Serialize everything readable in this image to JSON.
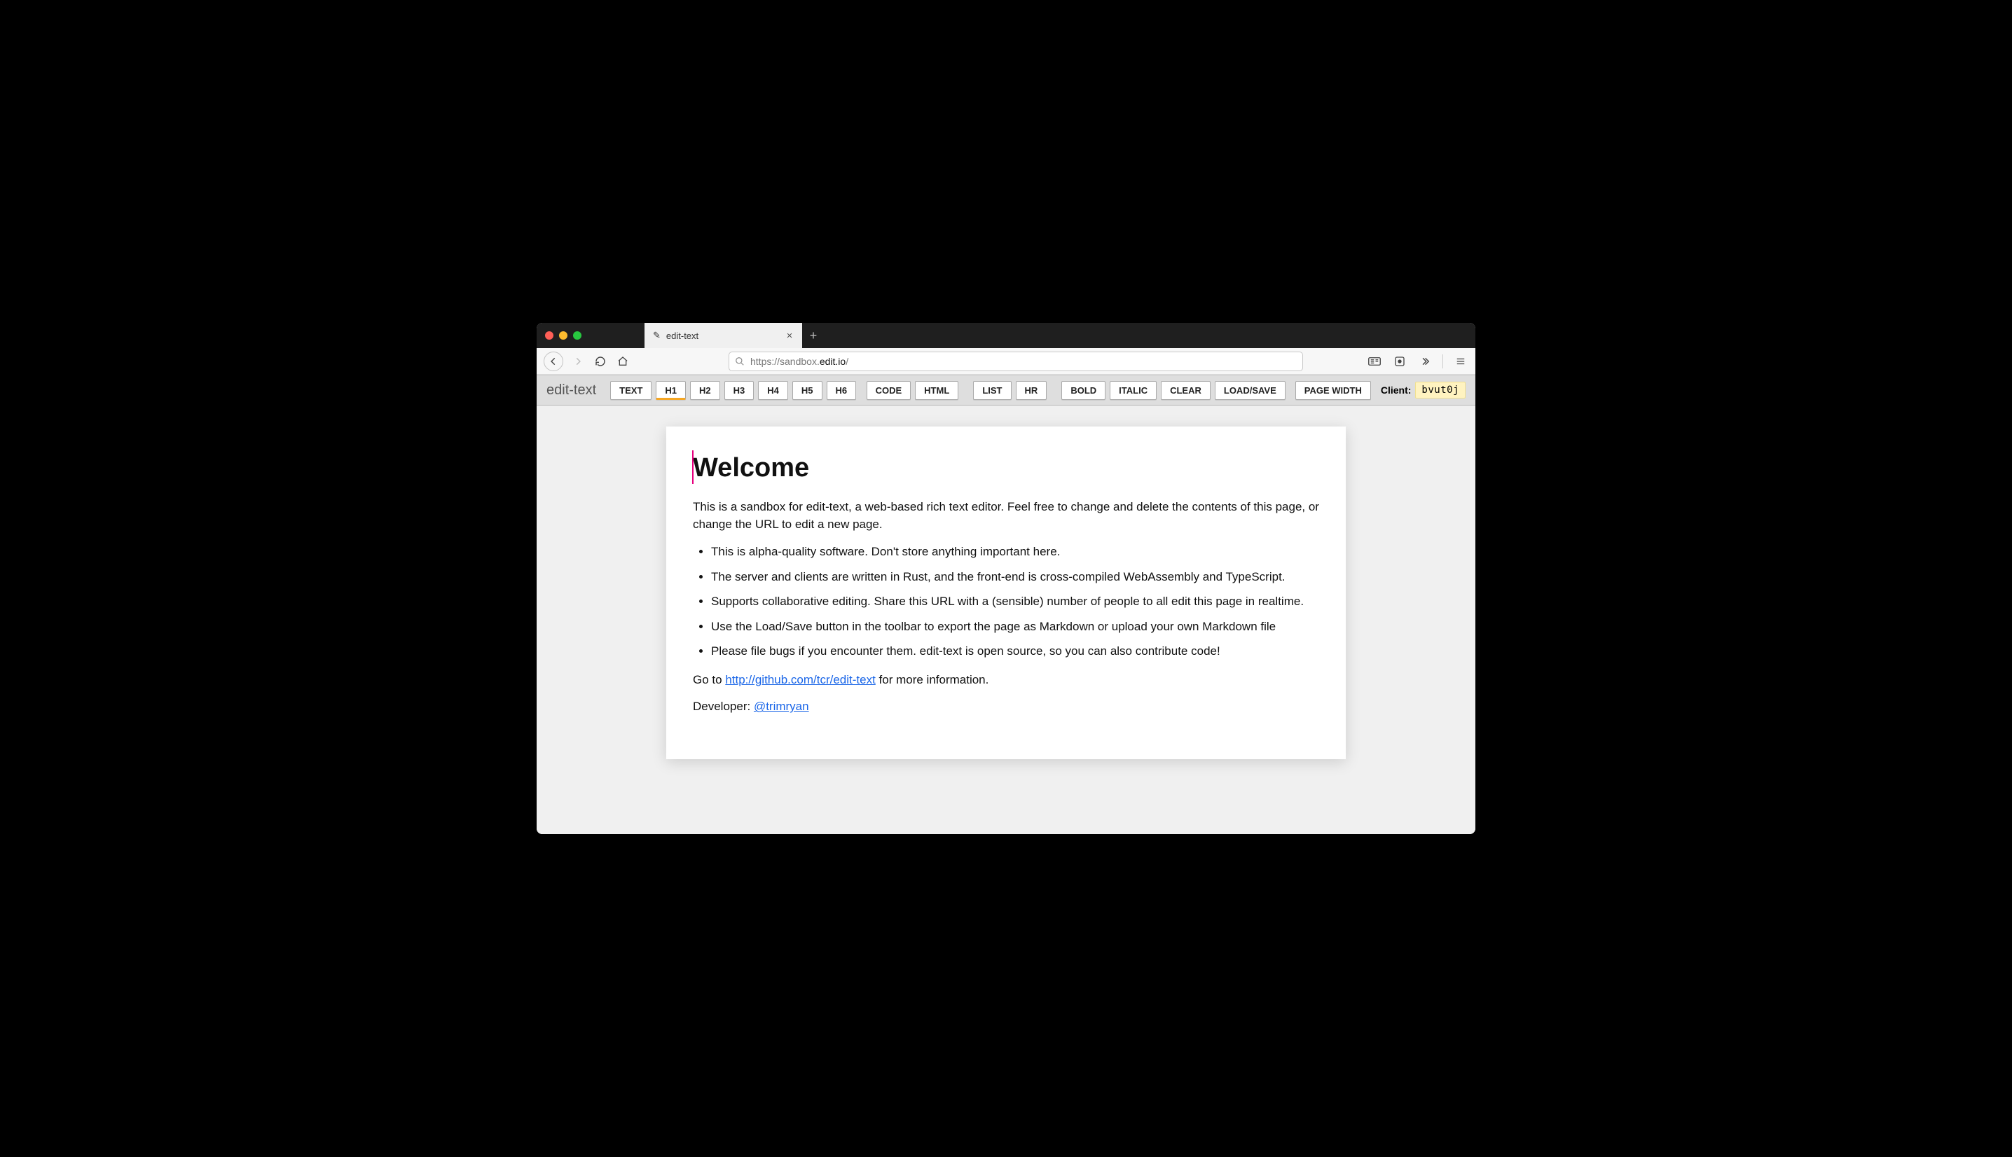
{
  "browser": {
    "tab": {
      "title": "edit-text",
      "favicon": "✎"
    },
    "url_prefix": "https://sandbox.",
    "url_mid": "edit.io",
    "url_suffix": "/"
  },
  "app": {
    "brand": "edit-text",
    "client_label": "Client:",
    "client_id": "bvut0j"
  },
  "toolbar": {
    "text": "TEXT",
    "h1": "H1",
    "h2": "H2",
    "h3": "H3",
    "h4": "H4",
    "h5": "H5",
    "h6": "H6",
    "code": "CODE",
    "html": "HTML",
    "list": "LIST",
    "hr": "HR",
    "bold": "BOLD",
    "italic": "ITALIC",
    "clear": "CLEAR",
    "loadsave": "LOAD/SAVE",
    "pagewidth": "PAGE WIDTH"
  },
  "doc": {
    "h1": "Welcome",
    "p1": "This is a sandbox for edit-text, a web-based rich text editor. Feel free to change and delete the contents of this page, or change the URL to edit a new page.",
    "bullets": [
      "This is alpha-quality software. Don't store anything important here.",
      "The server and clients are written in Rust, and the front-end is cross-compiled WebAssembly and TypeScript.",
      "Supports collaborative editing. Share this URL with a (sensible) number of people to all edit this page in realtime.",
      "Use the Load/Save button in the toolbar to export the page as Markdown or upload your own Markdown file",
      "Please file bugs if you encounter them. edit-text is open source, so you can also contribute code!"
    ],
    "p2_pre": "Go to ",
    "p2_link": "http://github.com/tcr/edit-text",
    "p2_post": " for more information.",
    "p3_pre": "Developer: ",
    "p3_link": "@trimryan"
  }
}
